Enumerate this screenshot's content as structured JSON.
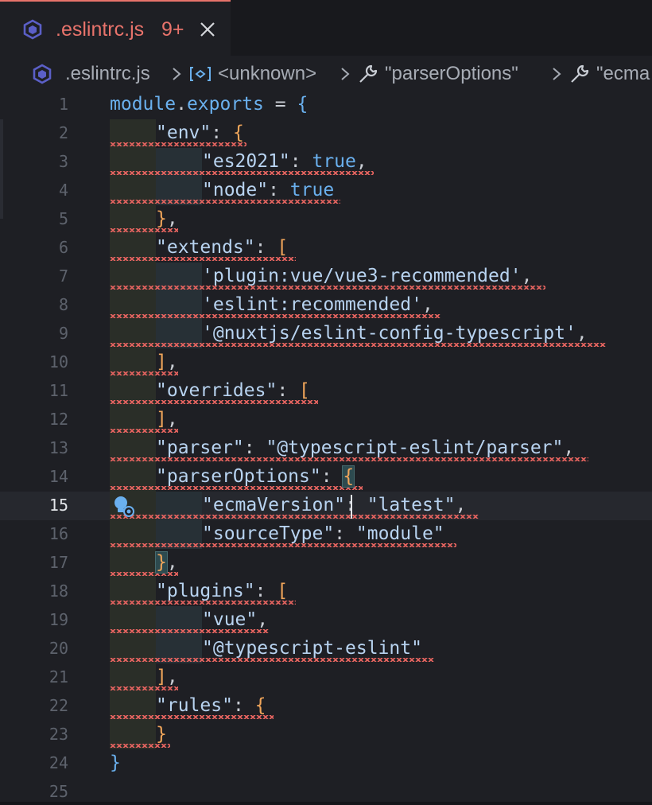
{
  "tab": {
    "label": ".eslintrc.js",
    "badge": "9+",
    "close_icon": "close-icon",
    "file_icon": "eslint-icon",
    "accent_color": "#e8736b"
  },
  "breadcrumb": {
    "items": [
      ".eslintrc.js",
      "<unknown>",
      "\"parserOptions\"",
      "\"ecma"
    ],
    "icons": [
      "eslint-icon",
      "variable-icon",
      "wrench-icon",
      "wrench-icon"
    ]
  },
  "editor": {
    "active_line": 15,
    "lines": [
      {
        "n": "1",
        "code": [
          [
            "k",
            "module"
          ],
          [
            "p",
            "."
          ],
          [
            "k",
            "exports"
          ],
          [
            "p",
            " = "
          ],
          [
            "n",
            "{"
          ]
        ]
      },
      {
        "n": "2",
        "code": [
          [
            "s",
            "\"env\""
          ],
          [
            "p",
            ": "
          ],
          [
            "b",
            "{"
          ]
        ]
      },
      {
        "n": "3",
        "code": [
          [
            "s",
            "\"es2021\""
          ],
          [
            "p",
            ": "
          ],
          [
            "k",
            "true"
          ],
          [
            "p",
            ","
          ]
        ]
      },
      {
        "n": "4",
        "code": [
          [
            "s",
            "\"node\""
          ],
          [
            "p",
            ": "
          ],
          [
            "k",
            "true"
          ]
        ]
      },
      {
        "n": "5",
        "code": [
          [
            "b",
            "}"
          ],
          [
            "p",
            ","
          ]
        ]
      },
      {
        "n": "6",
        "code": [
          [
            "s",
            "\"extends\""
          ],
          [
            "p",
            ": "
          ],
          [
            "b",
            "["
          ]
        ]
      },
      {
        "n": "7",
        "code": [
          [
            "s",
            "'plugin:vue/vue3-recommended'"
          ],
          [
            "p",
            ","
          ]
        ]
      },
      {
        "n": "8",
        "code": [
          [
            "s",
            "'eslint:recommended'"
          ],
          [
            "p",
            ","
          ]
        ]
      },
      {
        "n": "9",
        "code": [
          [
            "s",
            "'@nuxtjs/eslint-config-typescript'"
          ],
          [
            "p",
            ","
          ]
        ]
      },
      {
        "n": "10",
        "code": [
          [
            "b",
            "]"
          ],
          [
            "p",
            ","
          ]
        ]
      },
      {
        "n": "11",
        "code": [
          [
            "s",
            "\"overrides\""
          ],
          [
            "p",
            ": "
          ],
          [
            "b",
            "["
          ]
        ]
      },
      {
        "n": "12",
        "code": [
          [
            "b",
            "]"
          ],
          [
            "p",
            ","
          ]
        ]
      },
      {
        "n": "13",
        "code": [
          [
            "s",
            "\"parser\""
          ],
          [
            "p",
            ": "
          ],
          [
            "s",
            "\"@typescript-eslint/parser\""
          ],
          [
            "p",
            ","
          ]
        ]
      },
      {
        "n": "14",
        "code": [
          [
            "s",
            "\"parserOptions\""
          ],
          [
            "p",
            ": "
          ],
          [
            "b",
            "{"
          ]
        ]
      },
      {
        "n": "15",
        "code": [
          [
            "s",
            "\"ecmaVersion\""
          ],
          [
            "p",
            ": "
          ],
          [
            "s",
            "\"latest\""
          ],
          [
            "p",
            ","
          ]
        ]
      },
      {
        "n": "16",
        "code": [
          [
            "s",
            "\"sourceType\""
          ],
          [
            "p",
            ": "
          ],
          [
            "s",
            "\"module\""
          ]
        ]
      },
      {
        "n": "17",
        "code": [
          [
            "b",
            "}"
          ],
          [
            "p",
            ","
          ]
        ]
      },
      {
        "n": "18",
        "code": [
          [
            "s",
            "\"plugins\""
          ],
          [
            "p",
            ": "
          ],
          [
            "b",
            "["
          ]
        ]
      },
      {
        "n": "19",
        "code": [
          [
            "s",
            "\"vue\""
          ],
          [
            "p",
            ","
          ]
        ]
      },
      {
        "n": "20",
        "code": [
          [
            "s",
            "\"@typescript-eslint\""
          ]
        ]
      },
      {
        "n": "21",
        "code": [
          [
            "b",
            "]"
          ],
          [
            "p",
            ","
          ]
        ]
      },
      {
        "n": "22",
        "code": [
          [
            "s",
            "\"rules\""
          ],
          [
            "p",
            ": "
          ],
          [
            "b",
            "{"
          ]
        ]
      },
      {
        "n": "23",
        "code": [
          [
            "b",
            "}"
          ]
        ]
      },
      {
        "n": "24",
        "code": [
          [
            "n",
            "}"
          ]
        ]
      },
      {
        "n": "25",
        "code": []
      }
    ]
  }
}
